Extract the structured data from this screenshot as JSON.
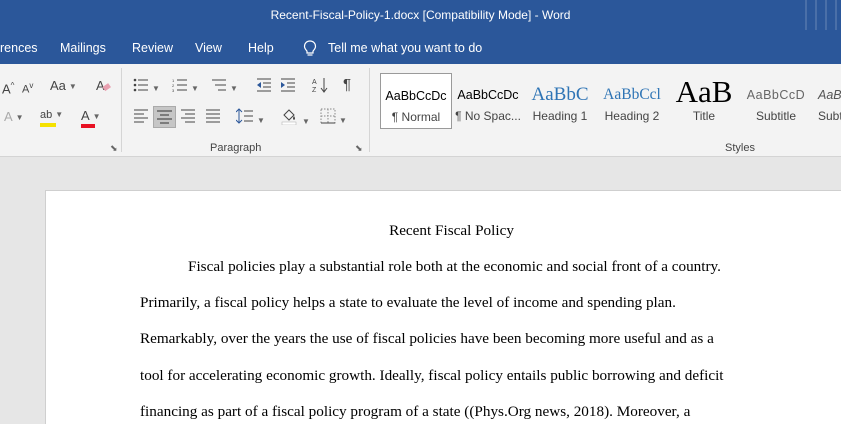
{
  "window": {
    "title": "Recent-Fiscal-Policy-1.docx [Compatibility Mode]  -  Word"
  },
  "menu": {
    "tabs": [
      "rences",
      "Mailings",
      "Review",
      "View",
      "Help"
    ],
    "tell_me": "Tell me what you want to do"
  },
  "ribbon": {
    "font_group": {
      "grow_label": "A",
      "shrink_label": "A",
      "case_label": "Aa",
      "clear_label": "A",
      "effects_label": "A",
      "highlight_label": "ab",
      "color_label": "A"
    },
    "paragraph_group": {
      "label": "Paragraph"
    },
    "styles_group": {
      "label": "Styles",
      "items": [
        {
          "preview": "AaBbCcDc",
          "name": "¶ Normal"
        },
        {
          "preview": "AaBbCcDc",
          "name": "¶ No Spac..."
        },
        {
          "preview": "AaBbC",
          "name": "Heading 1"
        },
        {
          "preview": "AaBbCcl",
          "name": "Heading 2"
        },
        {
          "preview": "AaB",
          "name": "Title"
        },
        {
          "preview": "AaBbCcD",
          "name": "Subtitle"
        },
        {
          "preview": "AaBl",
          "name": "Subtl"
        }
      ]
    },
    "colors": {
      "highlight": "#f5e100",
      "font_color": "#e81123"
    }
  },
  "document": {
    "title": "Recent Fiscal Policy",
    "lines": [
      "Fiscal policies play a substantial role both at the economic and social front of a country.",
      "Primarily, a fiscal policy helps a state to evaluate the level of income and spending plan.",
      "Remarkably, over the years the use of fiscal policies have been becoming more useful and as a",
      "tool for accelerating economic growth. Ideally, fiscal policy entails public borrowing and deficit",
      "financing as part of a fiscal policy program of a state ((Phys.Org news, 2018). Moreover, a"
    ]
  },
  "theme": {
    "accent": "#2b579a",
    "ribbon_bg": "#f3f3f3",
    "page_bg": "#ffffff"
  }
}
